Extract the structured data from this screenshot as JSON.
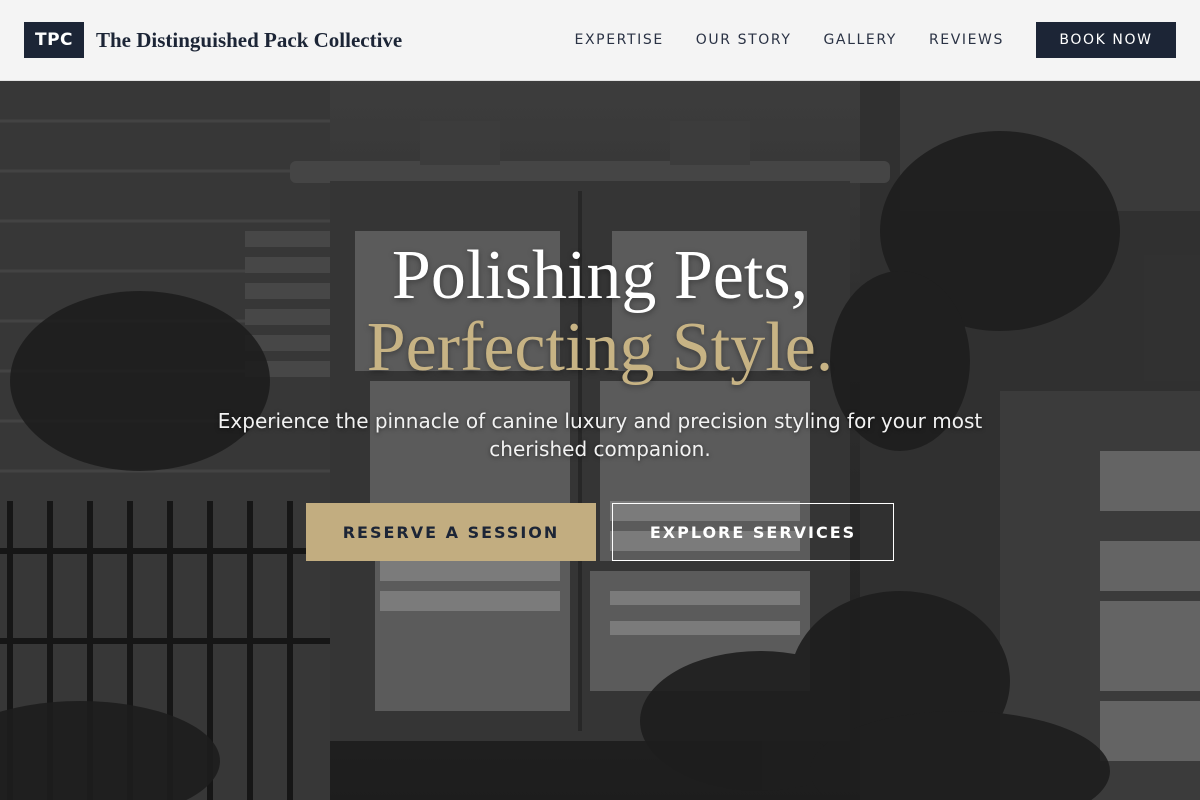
{
  "header": {
    "logo_text": "TPC",
    "brand_name": "The Distinguished Pack Collective",
    "nav": [
      {
        "label": "EXPERTISE"
      },
      {
        "label": "OUR STORY"
      },
      {
        "label": "GALLERY"
      },
      {
        "label": "REVIEWS"
      }
    ],
    "book_label": "BOOK NOW"
  },
  "hero": {
    "headline_line1": "Polishing Pets,",
    "headline_line2": "Perfecting Style.",
    "subtitle": "Experience the pinnacle of canine luxury and precision styling for your most cherished companion.",
    "primary_cta": "RESERVE A SESSION",
    "secondary_cta": "EXPLORE SERVICES",
    "background_image": "grayscale photo of weathered utility boxes covered in posters among plants"
  },
  "colors": {
    "navy": "#1c2536",
    "gold": "#c2ad80",
    "header_bg": "#f4f4f4"
  }
}
